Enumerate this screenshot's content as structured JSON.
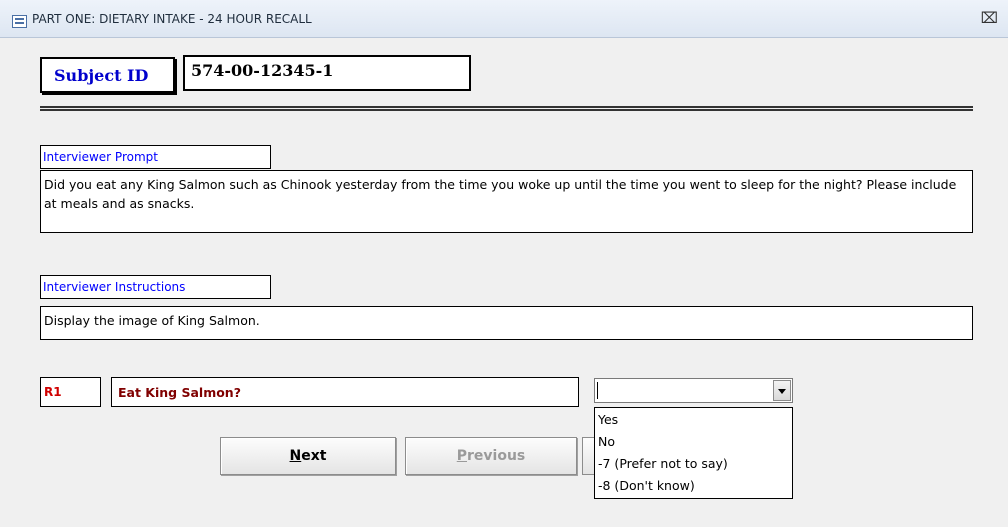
{
  "window": {
    "title": "PART ONE: DIETARY INTAKE - 24 HOUR RECALL",
    "title_icon": "form-icon",
    "close_glyph": "⌧"
  },
  "subject": {
    "label": "Subject ID",
    "value": "574-00-12345-1"
  },
  "prompt": {
    "label": "Interviewer Prompt",
    "text": "Did you eat any King Salmon such as Chinook yesterday from the time you woke up until the time you went to sleep for the night?  Please include at meals and as snacks."
  },
  "instructions": {
    "label": "Interviewer Instructions",
    "text": "Display the image of King Salmon."
  },
  "response": {
    "code": "R1",
    "question": "Eat King Salmon?",
    "selected": "",
    "options": [
      "Yes",
      "No",
      "-7 (Prefer not to say)",
      "-8 (Don't know)"
    ]
  },
  "buttons": {
    "next_prefix": "N",
    "next_rest": "ext",
    "previous_prefix": "P",
    "previous_rest": "revious"
  },
  "colors": {
    "label_blue": "#0000ff",
    "code_red": "#d00000",
    "question_maroon": "#800000"
  }
}
